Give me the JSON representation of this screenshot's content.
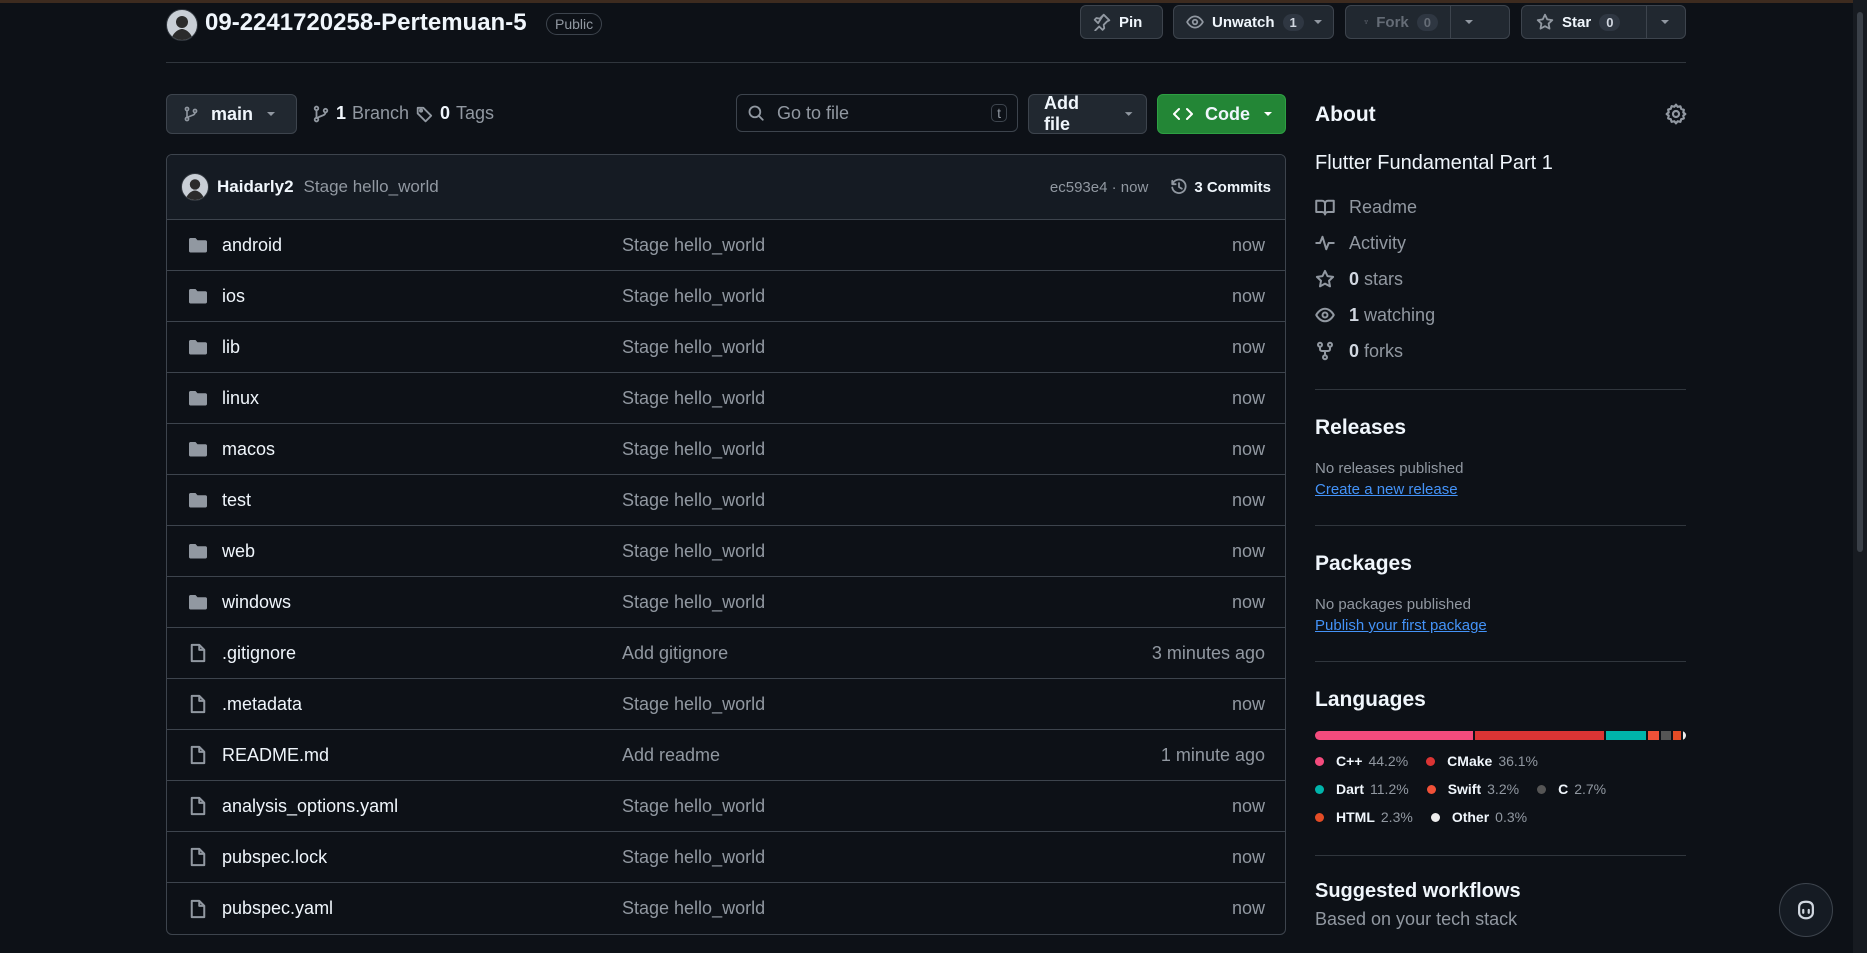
{
  "repo": {
    "name": "09-2241720258-Pertemuan-5",
    "visibility": "Public"
  },
  "actions": {
    "pin_label": "Pin",
    "unwatch_label": "Unwatch",
    "unwatch_count": "1",
    "fork_label": "Fork",
    "fork_count": "0",
    "star_label": "Star",
    "star_count": "0"
  },
  "toolbar": {
    "branch": "main",
    "branch_count": "1",
    "branch_label": "Branch",
    "tag_count": "0",
    "tag_label": "Tags",
    "search_placeholder": "Go to file",
    "search_shortcut": "t",
    "add_file_label": "Add file",
    "code_label": "Code"
  },
  "latest_commit": {
    "author": "Haidarly2",
    "message": "Stage hello_world",
    "hash": "ec593e4 · now",
    "commits_label": "3 Commits"
  },
  "files": [
    {
      "type": "folder",
      "name": "android",
      "message": "Stage hello_world",
      "time": "now"
    },
    {
      "type": "folder",
      "name": "ios",
      "message": "Stage hello_world",
      "time": "now"
    },
    {
      "type": "folder",
      "name": "lib",
      "message": "Stage hello_world",
      "time": "now"
    },
    {
      "type": "folder",
      "name": "linux",
      "message": "Stage hello_world",
      "time": "now"
    },
    {
      "type": "folder",
      "name": "macos",
      "message": "Stage hello_world",
      "time": "now"
    },
    {
      "type": "folder",
      "name": "test",
      "message": "Stage hello_world",
      "time": "now"
    },
    {
      "type": "folder",
      "name": "web",
      "message": "Stage hello_world",
      "time": "now"
    },
    {
      "type": "folder",
      "name": "windows",
      "message": "Stage hello_world",
      "time": "now"
    },
    {
      "type": "file",
      "name": ".gitignore",
      "message": "Add gitignore",
      "time": "3 minutes ago"
    },
    {
      "type": "file",
      "name": ".metadata",
      "message": "Stage hello_world",
      "time": "now"
    },
    {
      "type": "file",
      "name": "README.md",
      "message": "Add readme",
      "time": "1 minute ago"
    },
    {
      "type": "file",
      "name": "analysis_options.yaml",
      "message": "Stage hello_world",
      "time": "now"
    },
    {
      "type": "file",
      "name": "pubspec.lock",
      "message": "Stage hello_world",
      "time": "now"
    },
    {
      "type": "file",
      "name": "pubspec.yaml",
      "message": "Stage hello_world",
      "time": "now"
    }
  ],
  "about": {
    "title": "About",
    "description": "Flutter Fundamental Part 1",
    "readme": "Readme",
    "activity": "Activity",
    "stars_count": "0",
    "stars_label": "stars",
    "watching_count": "1",
    "watching_label": "watching",
    "forks_count": "0",
    "forks_label": "forks"
  },
  "releases": {
    "title": "Releases",
    "empty": "No releases published",
    "link": "Create a new release"
  },
  "packages": {
    "title": "Packages",
    "empty": "No packages published",
    "link": "Publish your first package"
  },
  "languages": {
    "title": "Languages",
    "items": [
      {
        "name": "C++",
        "percent": "44.2%",
        "value": 44.2,
        "color": "#f34b7d"
      },
      {
        "name": "CMake",
        "percent": "36.1%",
        "value": 36.1,
        "color": "#da3434"
      },
      {
        "name": "Dart",
        "percent": "11.2%",
        "value": 11.2,
        "color": "#00b4ab"
      },
      {
        "name": "Swift",
        "percent": "3.2%",
        "value": 3.2,
        "color": "#f05138"
      },
      {
        "name": "C",
        "percent": "2.7%",
        "value": 2.7,
        "color": "#555555"
      },
      {
        "name": "HTML",
        "percent": "2.3%",
        "value": 2.3,
        "color": "#e34c26"
      },
      {
        "name": "Other",
        "percent": "0.3%",
        "value": 0.3,
        "color": "#ededed"
      }
    ]
  },
  "suggested": {
    "title": "Suggested workflows",
    "subtitle": "Based on your tech stack"
  }
}
